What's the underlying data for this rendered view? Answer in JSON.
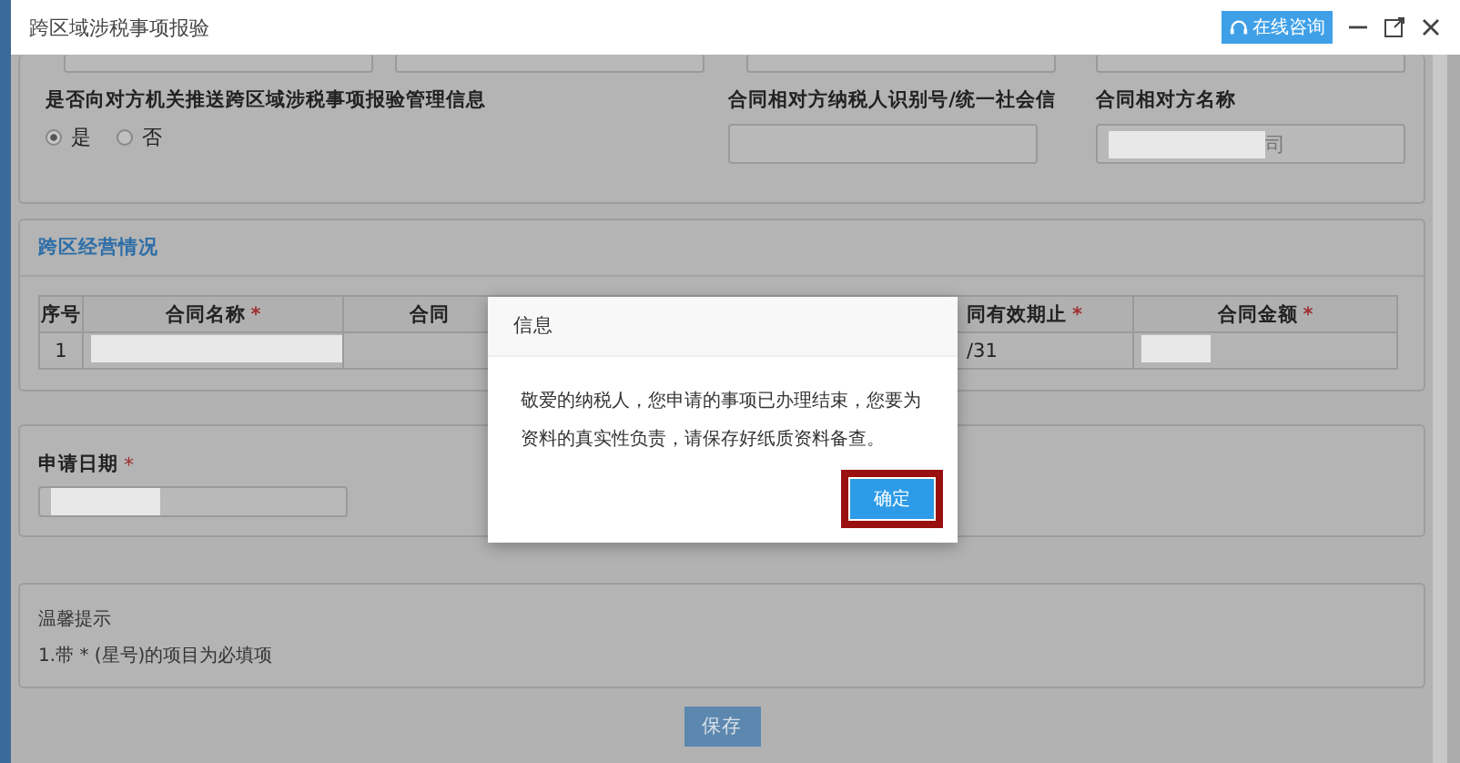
{
  "window": {
    "title": "跨区域涉税事项报验",
    "consult_button": "在线咨询"
  },
  "push_info": {
    "label": "是否向对方机关推送跨区域涉税事项报验管理信息",
    "options": [
      {
        "label": "是",
        "selected": true
      },
      {
        "label": "否",
        "selected": false
      }
    ]
  },
  "counterparty_id": {
    "label": "合同相对方纳税人识别号/统一社会信"
  },
  "counterparty_name": {
    "label": "合同相对方名称",
    "value": "司"
  },
  "business_section": {
    "title": "跨区经营情况",
    "columns": [
      {
        "label": "序号"
      },
      {
        "label": "合同名称",
        "mark": "*"
      },
      {
        "label": "合同"
      },
      {
        "label": "同有效期止",
        "mark": "*"
      },
      {
        "label": "合同金额",
        "mark": "*"
      }
    ],
    "rows": [
      {
        "index": "1",
        "column_4": "/31"
      }
    ]
  },
  "apply_date": {
    "label": "申请日期",
    "mark": "*"
  },
  "tips": {
    "title": "温馨提示",
    "items": [
      "1.带 * (星号)的项目为必填项"
    ]
  },
  "save_button": "保存",
  "dialog": {
    "title": "信息",
    "message": "敬爱的纳税人，您申请的事项已办理结束，您要为资料的真实性负责，请保存好纸质资料备查。",
    "confirm_button": "确定"
  }
}
